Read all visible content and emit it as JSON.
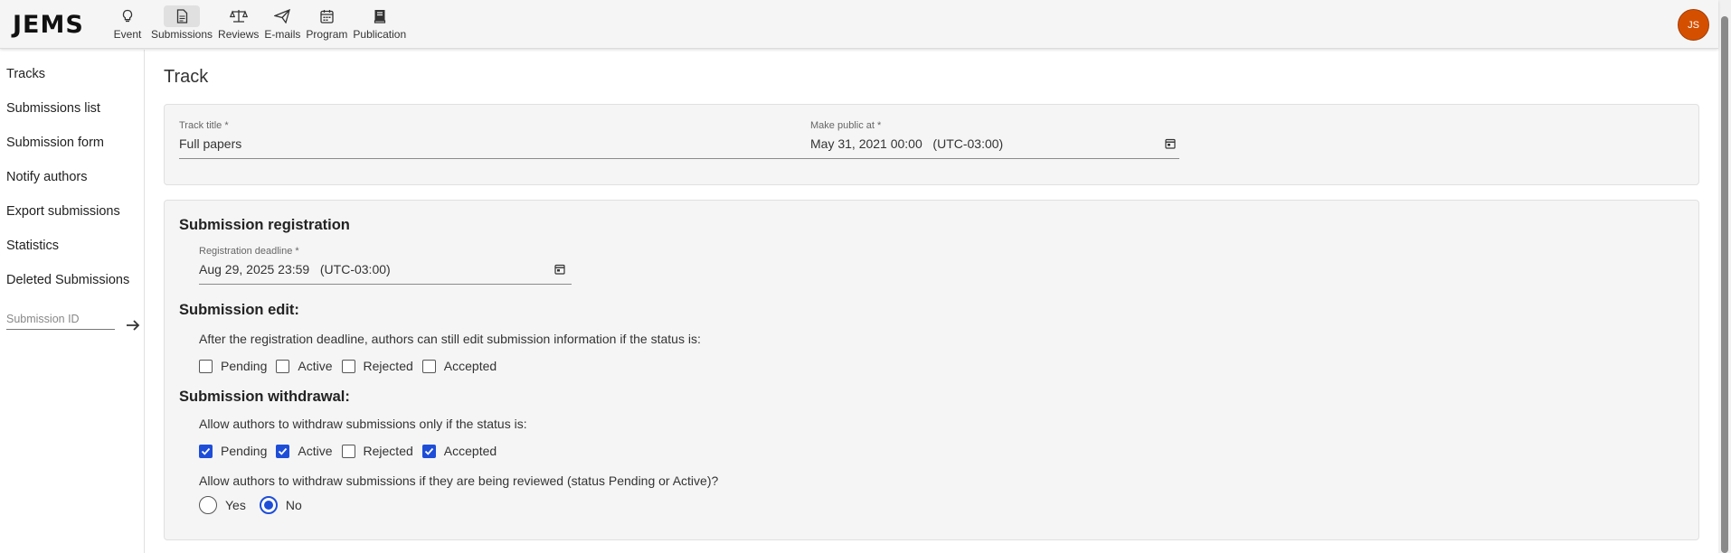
{
  "app": {
    "logo": "JEMS",
    "avatar_initials": "JS",
    "avatar_color": "#d45000"
  },
  "nav": {
    "items": [
      {
        "label": "Event",
        "icon": "lightbulb-icon"
      },
      {
        "label": "Submissions",
        "icon": "document-icon",
        "active": true
      },
      {
        "label": "Reviews",
        "icon": "scales-icon"
      },
      {
        "label": "E-mails",
        "icon": "paper-plane-icon"
      },
      {
        "label": "Program",
        "icon": "calendar-icon"
      },
      {
        "label": "Publication",
        "icon": "book-icon"
      }
    ]
  },
  "sidebar": {
    "items": [
      {
        "label": "Tracks"
      },
      {
        "label": "Submissions list"
      },
      {
        "label": "Submission form"
      },
      {
        "label": "Notify authors"
      },
      {
        "label": "Export submissions"
      },
      {
        "label": "Statistics"
      },
      {
        "label": "Deleted Submissions"
      }
    ],
    "submission_id_placeholder": "Submission ID"
  },
  "main": {
    "title": "Track",
    "track_title": {
      "label": "Track title *",
      "value": "Full papers"
    },
    "make_public": {
      "label": "Make public at *",
      "value": "May 31, 2021 00:00   (UTC-03:00)"
    },
    "registration": {
      "heading": "Submission registration",
      "deadline_label": "Registration deadline *",
      "deadline_value": "Aug 29, 2025 23:59   (UTC-03:00)"
    },
    "edit": {
      "heading": "Submission edit:",
      "description": "After the registration deadline, authors can still edit submission information if the status is:",
      "options": [
        {
          "label": "Pending",
          "checked": false
        },
        {
          "label": "Active",
          "checked": false
        },
        {
          "label": "Rejected",
          "checked": false
        },
        {
          "label": "Accepted",
          "checked": false
        }
      ]
    },
    "withdrawal": {
      "heading": "Submission withdrawal:",
      "description": "Allow authors to withdraw submissions only if the status is:",
      "options": [
        {
          "label": "Pending",
          "checked": true
        },
        {
          "label": "Active",
          "checked": true
        },
        {
          "label": "Rejected",
          "checked": false
        },
        {
          "label": "Accepted",
          "checked": true
        }
      ],
      "review_question": "Allow authors to withdraw submissions if they are being reviewed (status Pending or Active)?",
      "radio": [
        {
          "label": "Yes",
          "selected": false
        },
        {
          "label": "No",
          "selected": true
        }
      ]
    }
  },
  "colors": {
    "accent": "#1e4ed8",
    "panel_bg": "#f5f5f5"
  }
}
